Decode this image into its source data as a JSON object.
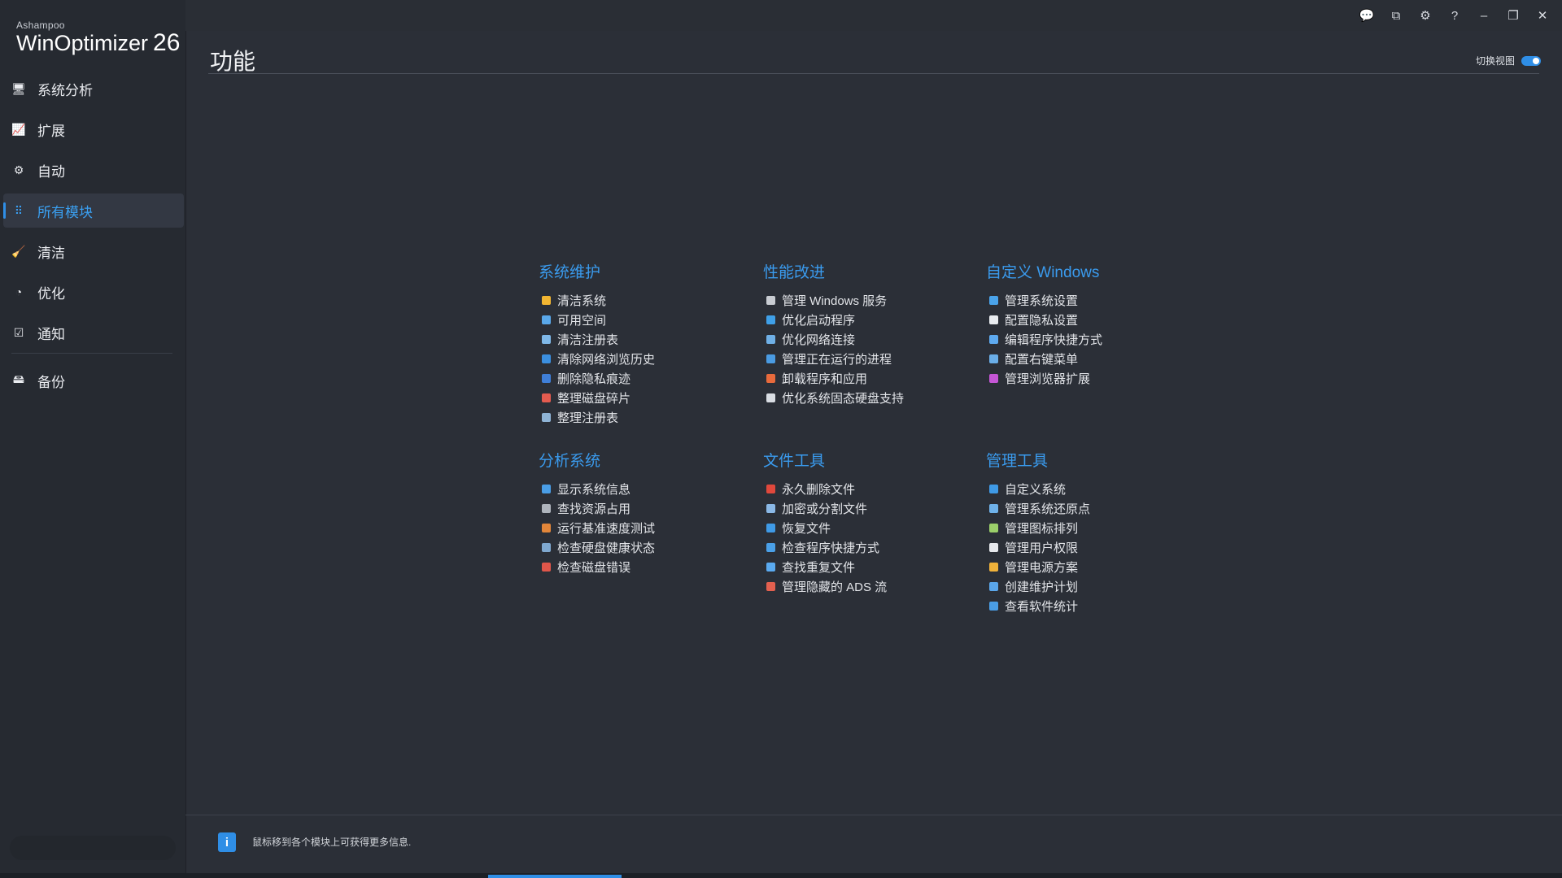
{
  "app": {
    "brand": "Ashampoo",
    "product": "WinOptimizer",
    "version": "26"
  },
  "colors": {
    "accent": "#2f8ee6",
    "section_title": "#3a9bee",
    "background": "#2b2f37",
    "sidebar": "#262a31"
  },
  "window_controls": [
    {
      "name": "feedback-icon",
      "glyph": "💬"
    },
    {
      "name": "compact-view-icon",
      "glyph": "⧉"
    },
    {
      "name": "settings-gear-icon",
      "glyph": "⚙"
    },
    {
      "name": "help-icon",
      "glyph": "?"
    },
    {
      "name": "minimize-icon",
      "glyph": "–"
    },
    {
      "name": "restore-icon",
      "glyph": "❐"
    },
    {
      "name": "close-icon",
      "glyph": "✕"
    }
  ],
  "sidebar": {
    "items": [
      {
        "label": "系统分析",
        "icon": "monitor-icon",
        "glyph": "🖥",
        "active": false
      },
      {
        "label": "扩展",
        "icon": "chart-icon",
        "glyph": "📈",
        "active": false
      },
      {
        "label": "自动",
        "icon": "automation-gear-icon",
        "glyph": "⚙",
        "active": false
      },
      {
        "label": "所有模块",
        "icon": "grid-icon",
        "glyph": "⠿",
        "active": true
      },
      {
        "label": "清洁",
        "icon": "broom-icon",
        "glyph": "🧹",
        "active": false
      },
      {
        "label": "优化",
        "icon": "speedometer-icon",
        "glyph": "◔",
        "active": false
      },
      {
        "label": "通知",
        "icon": "checkbox-icon",
        "glyph": "☑",
        "active": false
      },
      {
        "label": "备份",
        "icon": "backup-drive-icon",
        "glyph": "🖴",
        "active": false
      }
    ]
  },
  "main": {
    "title": "功能",
    "view_toggle_label": "切换视图",
    "sections": [
      {
        "title": "系统维护",
        "modules": [
          {
            "label": "清洁系统",
            "color": "#f2b632"
          },
          {
            "label": "可用空间",
            "color": "#5aa8ea"
          },
          {
            "label": "清洁注册表",
            "color": "#7fb8e8"
          },
          {
            "label": "清除网络浏览历史",
            "color": "#3b8fe0"
          },
          {
            "label": "删除隐私痕迹",
            "color": "#3f7fd8"
          },
          {
            "label": "整理磁盘碎片",
            "color": "#e45b4f"
          },
          {
            "label": "整理注册表",
            "color": "#8fb4d6"
          }
        ]
      },
      {
        "title": "性能改进",
        "modules": [
          {
            "label": "管理 Windows 服务",
            "color": "#c8ccd2"
          },
          {
            "label": "优化启动程序",
            "color": "#3fa0e8"
          },
          {
            "label": "优化网络连接",
            "color": "#6fb0e6"
          },
          {
            "label": "管理正在运行的进程",
            "color": "#4a9be2"
          },
          {
            "label": "卸载程序和应用",
            "color": "#e86a3c"
          },
          {
            "label": "优化系统固态硬盘支持",
            "color": "#d9dde3"
          }
        ]
      },
      {
        "title": "自定义 Windows",
        "modules": [
          {
            "label": "管理系统设置",
            "color": "#4aa3ea"
          },
          {
            "label": "配置隐私设置",
            "color": "#e9ecf0"
          },
          {
            "label": "编辑程序快捷方式",
            "color": "#5eaaf0"
          },
          {
            "label": "配置右键菜单",
            "color": "#6aaee8"
          },
          {
            "label": "管理浏览器扩展",
            "color": "#c556d6"
          }
        ]
      },
      {
        "title": "分析系统",
        "modules": [
          {
            "label": "显示系统信息",
            "color": "#4a9ee6"
          },
          {
            "label": "查找资源占用",
            "color": "#aeb4bc"
          },
          {
            "label": "运行基准速度测试",
            "color": "#e2863a"
          },
          {
            "label": "检查硬盘健康状态",
            "color": "#7fa8cf"
          },
          {
            "label": "检查磁盘错误",
            "color": "#e0564a"
          }
        ]
      },
      {
        "title": "文件工具",
        "modules": [
          {
            "label": "永久删除文件",
            "color": "#e0483c"
          },
          {
            "label": "加密或分割文件",
            "color": "#8ab8e6"
          },
          {
            "label": "恢复文件",
            "color": "#3f9ae6"
          },
          {
            "label": "检查程序快捷方式",
            "color": "#4aa0e8"
          },
          {
            "label": "查找重复文件",
            "color": "#5aaaf0"
          },
          {
            "label": "管理隐藏的 ADS 流",
            "color": "#e3604f"
          }
        ]
      },
      {
        "title": "管理工具",
        "modules": [
          {
            "label": "自定义系统",
            "color": "#3f9ae6"
          },
          {
            "label": "管理系统还原点",
            "color": "#6fb2ea"
          },
          {
            "label": "管理图标排列",
            "color": "#9bcf6a"
          },
          {
            "label": "管理用户权限",
            "color": "#e6e8ec"
          },
          {
            "label": "管理电源方案",
            "color": "#f0b23a"
          },
          {
            "label": "创建维护计划",
            "color": "#5aa6ea"
          },
          {
            "label": "查看软件统计",
            "color": "#4a9ee6"
          }
        ]
      }
    ]
  },
  "footer": {
    "info_text": "鼠标移到各个模块上可获得更多信息."
  }
}
